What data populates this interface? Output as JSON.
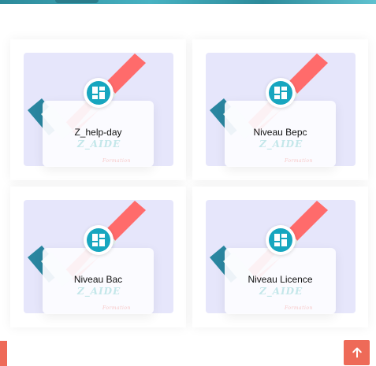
{
  "courses": [
    {
      "title": "Z_help-day"
    },
    {
      "title": "Niveau Bepc"
    },
    {
      "title": "Niveau Bac"
    },
    {
      "title": "Niveau Licence"
    }
  ],
  "thumbnail": {
    "brand": "Z_AIDE",
    "tagline": "Formation",
    "colors": {
      "background": "#e6e6fb",
      "red": "#ff6b6b",
      "teal": "#2a86a0",
      "checkmark": "#e4f3f1"
    }
  },
  "badge": {
    "icon": "grid-icon",
    "color": "#17a6bf"
  },
  "scroll_top": {
    "icon": "arrow-up-icon",
    "color": "#ee6a58"
  },
  "banner_color": "#2c8a9a"
}
